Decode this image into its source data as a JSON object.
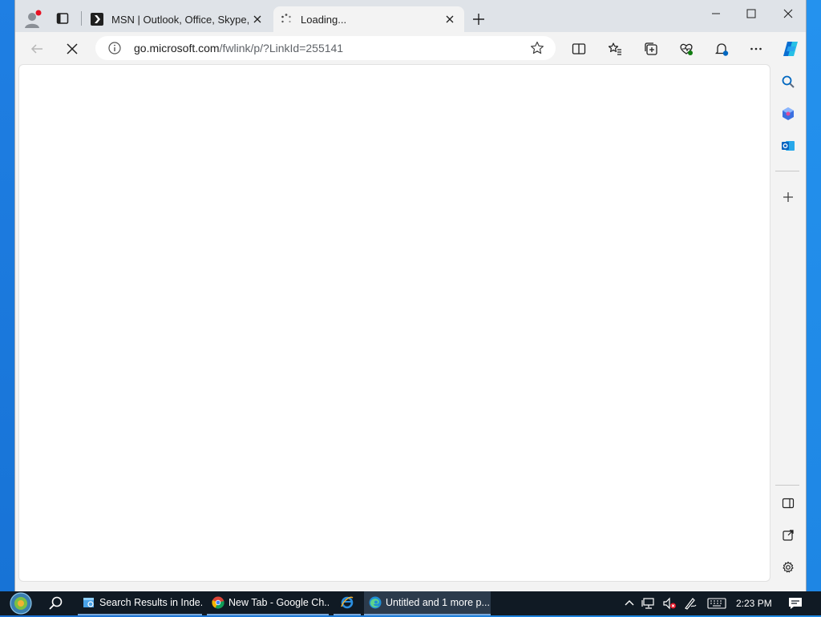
{
  "browser": {
    "tabs": [
      {
        "title": "MSN | Outlook, Office, Skype, Bing",
        "active": false
      },
      {
        "title": "Loading...",
        "active": true
      }
    ],
    "address": {
      "host": "go.microsoft.com",
      "path": "/fwlink/p/?LinkId=255141"
    }
  },
  "taskbar": {
    "items": [
      {
        "label": "Search Results in Inde..."
      },
      {
        "label": "New Tab - Google Ch..."
      },
      {
        "label": ""
      },
      {
        "label": "Untitled and 1 more p..."
      }
    ],
    "clock": "2:23 PM"
  },
  "colors": {
    "accent": "#0067c0",
    "tabstrip": "#dfe3e8",
    "toolbar": "#f3f3f3",
    "taskbar": "#101a24",
    "notification_badge": "#e81123"
  }
}
